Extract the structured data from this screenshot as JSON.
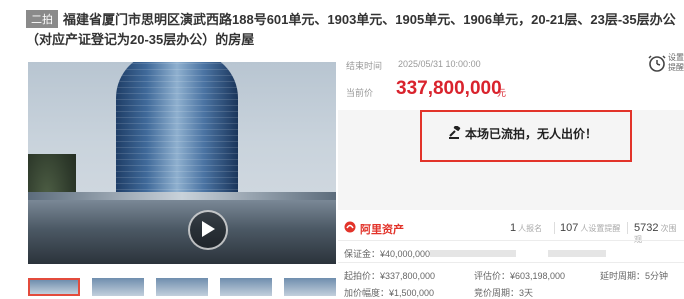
{
  "title": {
    "badge": "二拍",
    "text": "福建省厦门市思明区演武西路188号601单元、1903单元、1905单元、1906单元，20-21层、23层-35层办公（对应产证登记为20-35层办公）的房屋"
  },
  "auction": {
    "end_time_label": "结束时间",
    "end_time_value": "2025/05/31 10:00:00",
    "current_price_label": "当前价",
    "current_price": "337,800,000",
    "currency_unit": "元",
    "remind_label": "设置提醒",
    "status_message": "本场已流拍，无人出价！"
  },
  "stats": {
    "platform": "阿里资产",
    "signups_count": "1",
    "signups_label": "人报名",
    "reminders_count": "107",
    "reminders_label": "人设置提醒",
    "views_count": "5732",
    "views_label": "次围观"
  },
  "details": {
    "deposit": "保证金：¥40,000,000",
    "starting_price": "起拍价：¥337,800,000",
    "appraisal_price": "评估价：¥603,198,000",
    "extension_cycle": "延时周期：5分钟",
    "increment": "加价幅度：¥1,500,000",
    "bidding_cycle": "竞价周期：3天"
  },
  "colors": {
    "accent_red": "#d9232d",
    "highlight_box": "#e2332a",
    "badge_gray": "#8a8a8a"
  }
}
